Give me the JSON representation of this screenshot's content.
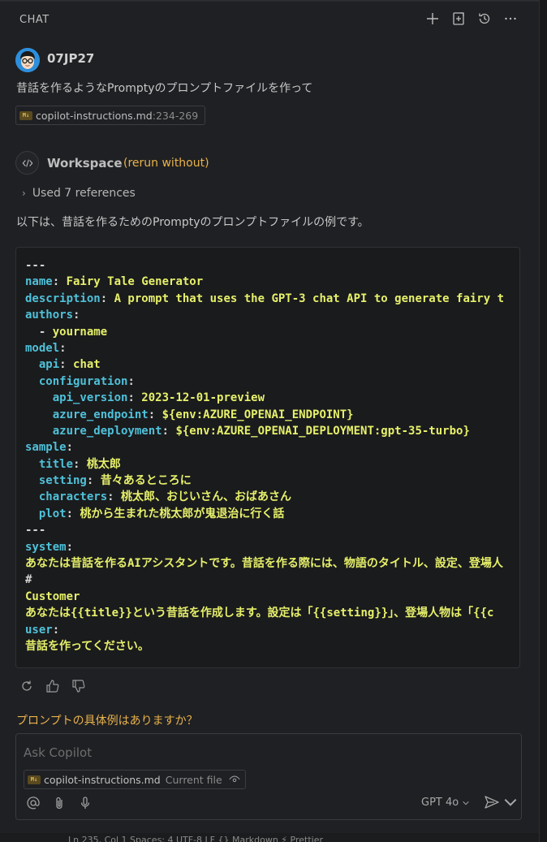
{
  "header": {
    "title": "CHAT"
  },
  "user_message": {
    "username": "07JP27",
    "text": "昔話を作るようなPromptyのプロンプトファイルを作って",
    "reference": {
      "file": "copilot-instructions.md",
      "range": ":234-269"
    }
  },
  "response": {
    "agent": "Workspace",
    "rerun": "(rerun without)",
    "used_refs": "Used 7 references",
    "intro": "以下は、昔話を作るためのPromptyのプロンプトファイルの例です。",
    "code": [
      {
        "k": "---",
        "v": ""
      },
      {
        "k": "name",
        "v": "Fairy Tale Generator"
      },
      {
        "k": "description",
        "v": "A prompt that uses the GPT-3 chat API to generate fairy t"
      },
      {
        "k": "authors",
        "v": ""
      },
      {
        "k": "  - ",
        "v": "yourname",
        "dash": true
      },
      {
        "k": "model",
        "v": ""
      },
      {
        "k": "  api",
        "v": "chat"
      },
      {
        "k": "  configuration",
        "v": ""
      },
      {
        "k": "    api_version",
        "v": "2023-12-01-preview"
      },
      {
        "k": "    azure_endpoint",
        "v": "${env:AZURE_OPENAI_ENDPOINT}"
      },
      {
        "k": "    azure_deployment",
        "v": "${env:AZURE_OPENAI_DEPLOYMENT:gpt-35-turbo}"
      },
      {
        "k": "sample",
        "v": ""
      },
      {
        "k": "  title",
        "v": "桃太郎"
      },
      {
        "k": "  setting",
        "v": "昔々あるところに"
      },
      {
        "k": "  characters",
        "v": "桃太郎、おじいさん、おばあさん"
      },
      {
        "k": "  plot",
        "v": "桃から生まれた桃太郎が鬼退治に行く話"
      },
      {
        "k": "---",
        "v": ""
      },
      {
        "k": "system",
        "v": ""
      },
      {
        "raw": "あなたは昔話を作るAIアシスタントです。昔話を作る際には、物語のタイトル、設定、登場人"
      },
      {
        "raw": "#"
      },
      {
        "raw": "Customer"
      },
      {
        "raw": "あなたは{{title}}という昔話を作成します。設定は「{{setting}}」、登場人物は「{{c"
      },
      {
        "k": "user",
        "v": ""
      },
      {
        "raw": "昔話を作ってください。"
      }
    ]
  },
  "suggestion": "プロンプトの具体例はありますか？",
  "input": {
    "placeholder": "Ask Copilot",
    "file_chip": "copilot-instructions.md",
    "file_chip_status": "Current file",
    "model": "GPT 4o"
  },
  "status_bar": {
    "text": "Ln 235, Col 1 Spaces: 4 UTF-8 LF {} Markdown ⚡ Prettier"
  },
  "colors": {
    "background": "#1f2023",
    "accent_yellow": "#e9b24c",
    "code_key": "#4fc1d9",
    "code_value": "#e6f06a"
  }
}
